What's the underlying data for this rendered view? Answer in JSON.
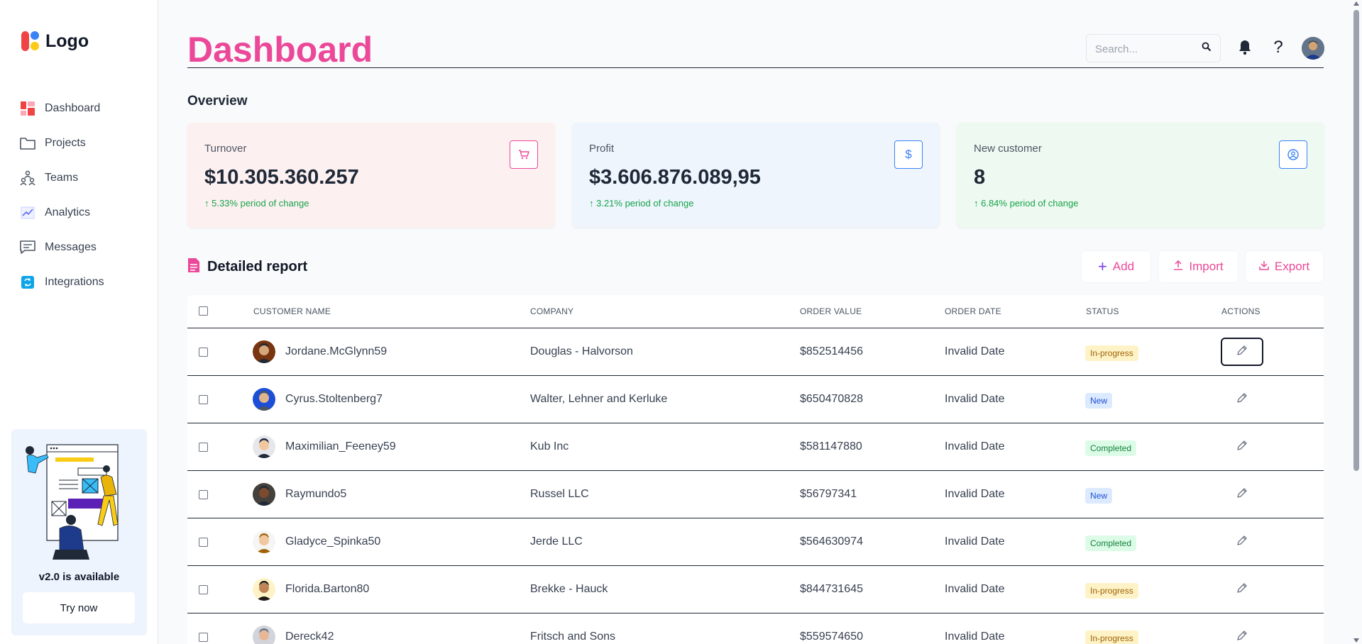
{
  "brand": {
    "logo_text": "Logo"
  },
  "sidebar": {
    "items": [
      {
        "label": "Dashboard",
        "icon": "dashboard-icon"
      },
      {
        "label": "Projects",
        "icon": "folder-icon"
      },
      {
        "label": "Teams",
        "icon": "teams-icon"
      },
      {
        "label": "Analytics",
        "icon": "analytics-icon"
      },
      {
        "label": "Messages",
        "icon": "messages-icon"
      },
      {
        "label": "Integrations",
        "icon": "integrations-icon"
      }
    ],
    "promo": {
      "title": "v2.0 is available",
      "button": "Try now"
    }
  },
  "header": {
    "title": "Dashboard",
    "search_placeholder": "Search...",
    "help": "?"
  },
  "overview": {
    "title": "Overview",
    "cards": [
      {
        "label": "Turnover",
        "value": "$10.305.360.257",
        "change": "↑ 5.33% period of change",
        "bg": "#fdf0f0",
        "accent": "#ec4899",
        "icon": "cart-icon"
      },
      {
        "label": "Profit",
        "value": "$3.606.876.089,95",
        "change": "↑ 3.21% period of change",
        "bg": "#eef5fd",
        "accent": "#3b82f6",
        "icon": "dollar-icon"
      },
      {
        "label": "New customer",
        "value": "8",
        "change": "↑ 6.84% period of change",
        "bg": "#eefaf1",
        "accent": "#3b82f6",
        "icon": "user-circle-icon"
      }
    ]
  },
  "report": {
    "title": "Detailed report",
    "actions": {
      "add": "Add",
      "import": "Import",
      "export": "Export"
    },
    "columns": [
      "CUSTOMER NAME",
      "COMPANY",
      "ORDER VALUE",
      "ORDER DATE",
      "STATUS",
      "ACTIONS"
    ],
    "rows": [
      {
        "name": "Jordane.McGlynn59",
        "company": "Douglas - Halvorson",
        "value": "$852514456",
        "date": "Invalid Date",
        "status": "In-progress"
      },
      {
        "name": "Cyrus.Stoltenberg7",
        "company": "Walter, Lehner and Kerluke",
        "value": "$650470828",
        "date": "Invalid Date",
        "status": "New"
      },
      {
        "name": "Maximilian_Feeney59",
        "company": "Kub Inc",
        "value": "$581147880",
        "date": "Invalid Date",
        "status": "Completed"
      },
      {
        "name": "Raymundo5",
        "company": "Russel LLC",
        "value": "$56797341",
        "date": "Invalid Date",
        "status": "New"
      },
      {
        "name": "Gladyce_Spinka50",
        "company": "Jerde LLC",
        "value": "$564630974",
        "date": "Invalid Date",
        "status": "Completed"
      },
      {
        "name": "Florida.Barton80",
        "company": "Brekke - Hauck",
        "value": "$844731645",
        "date": "Invalid Date",
        "status": "In-progress"
      },
      {
        "name": "Dereck42",
        "company": "Fritsch and Sons",
        "value": "$559574650",
        "date": "Invalid Date",
        "status": "In-progress"
      }
    ],
    "status_colors": {
      "In-progress": {
        "bg": "#fef3c7",
        "fg": "#a16207"
      },
      "New": {
        "bg": "#dbeafe",
        "fg": "#1d4ed8"
      },
      "Completed": {
        "bg": "#dcfce7",
        "fg": "#15803d"
      }
    }
  }
}
